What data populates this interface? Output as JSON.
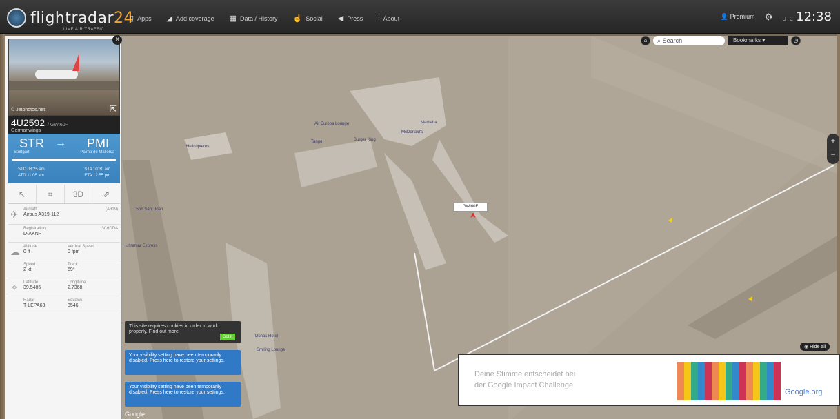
{
  "brand": {
    "name_a": "flightradar",
    "name_b": "24",
    "tagline": "LIVE AIR TRAFFIC"
  },
  "nav": [
    {
      "label": "Apps",
      "icon": "phone-icon"
    },
    {
      "label": "Add coverage",
      "icon": "antenna-icon"
    },
    {
      "label": "Data / History",
      "icon": "database-icon"
    },
    {
      "label": "Social",
      "icon": "thumbs-up-icon"
    },
    {
      "label": "Press",
      "icon": "megaphone-icon"
    },
    {
      "label": "About",
      "icon": "info-icon"
    }
  ],
  "account": {
    "label": "Premium",
    "clock_tz": "UTC",
    "clock": "12:38"
  },
  "map_controls": {
    "search_placeholder": "Search",
    "bookmarks": "Bookmarks",
    "hide_all": "Hide all"
  },
  "flight": {
    "number": "4U2592",
    "callsign": "GWI60F",
    "airline": "Germanwings",
    "photo_credit": "© Jetphotos.net",
    "from_code": "STR",
    "from_city": "Stuttgart",
    "to_code": "PMI",
    "to_city": "Palma de Mallorca",
    "progress": 1.0,
    "dep_sched": "STD 08:25 am",
    "dep_actual": "ATD 11:05 am",
    "arr_sched": "STA 10:30 am",
    "arr_actual": "ETA 12:55 pm",
    "details": [
      {
        "label_a": "Aircraft",
        "value_a": "Airbus A319-112",
        "label_b": "",
        "value_b": "(A319)"
      },
      {
        "label_a": "Registration",
        "value_a": "D-AKNF",
        "label_b": "",
        "value_b": "3C6DDA"
      },
      {
        "label_a": "Altitude",
        "value_a": "0 ft",
        "label_b": "Vertical Speed",
        "value_b": "0 fpm"
      },
      {
        "label_a": "Speed",
        "value_a": "2 kt",
        "label_b": "Track",
        "value_b": "59°"
      },
      {
        "label_a": "Latitude",
        "value_a": "39.5485",
        "label_b": "Longitude",
        "value_b": "2.7368"
      },
      {
        "label_a": "Radar",
        "value_a": "T-LEPA63",
        "label_b": "Squawk",
        "value_b": "3546"
      }
    ]
  },
  "toasts": {
    "cookie": "This site requires cookies in order to work properly. Find out more",
    "cookie_ok": "Got it",
    "vis1": "Your visibility setting have been temporarily disabled. Press here to restore your settings.",
    "vis2": "Your visibility setting have been temporarily disabled. Press here to restore your settings."
  },
  "ad": {
    "line1": "Deine Stimme entscheidet bei",
    "line2": "der Google Impact Challenge",
    "brand": "Google.org"
  },
  "map_labels": {
    "callsign_tag": "GWI60F",
    "l1": "Air Europa Lounge",
    "l2": "Tango",
    "l3": "Marhaba",
    "l4": "McDonald's",
    "l5": "Burger King",
    "l6": "Helicópteros",
    "l7": "Son Sant Joan",
    "l8": "Ultramar Express",
    "l9": "Dunas Hotel",
    "l10": "Smiling Lounge"
  },
  "gmaps_label": "Google"
}
